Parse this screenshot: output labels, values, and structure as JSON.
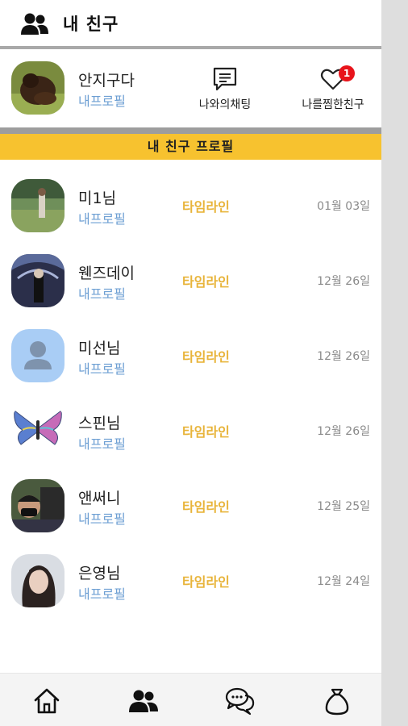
{
  "header": {
    "title": "내 친구",
    "icon": "friends-icon"
  },
  "my_profile": {
    "name": "안지구다",
    "sub": "내프로필",
    "actions": {
      "chat_label": "나와의채팅",
      "liked_label": "나를찜한친구",
      "liked_badge": "1"
    }
  },
  "section": {
    "title": "내 친구 프로필"
  },
  "friends": [
    {
      "name": "미1님",
      "sub": "내프로필",
      "timeline": "타임라인",
      "date": "01월 03일"
    },
    {
      "name": "웬즈데이",
      "sub": "내프로필",
      "timeline": "타임라인",
      "date": "12월 26일"
    },
    {
      "name": "미선님",
      "sub": "내프로필",
      "timeline": "타임라인",
      "date": "12월 26일"
    },
    {
      "name": "스핀님",
      "sub": "내프로필",
      "timeline": "타임라인",
      "date": "12월 26일"
    },
    {
      "name": "앤써니",
      "sub": "내프로필",
      "timeline": "타임라인",
      "date": "12월 25일"
    },
    {
      "name": "은영님",
      "sub": "내프로필",
      "timeline": "타임라인",
      "date": "12월 24일"
    }
  ],
  "bottom_nav": [
    "home-icon",
    "friends-icon",
    "chat-bubbles-icon",
    "money-bag-icon"
  ],
  "colors": {
    "accent": "#f7c22f",
    "timeline": "#e8b43a",
    "link": "#6d9fd3",
    "badge": "#e8141b"
  }
}
